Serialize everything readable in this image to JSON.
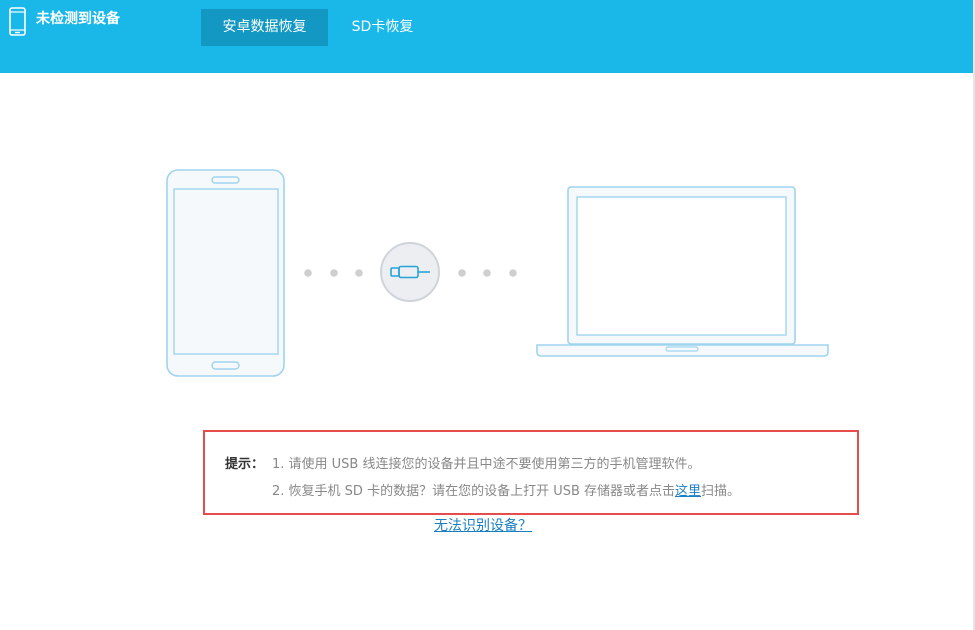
{
  "header": {
    "device_status": "未检测到设备",
    "tabs": [
      {
        "label": "安卓数据恢复",
        "active": true
      },
      {
        "label": "SD卡恢复",
        "active": false
      }
    ]
  },
  "main": {
    "connector_icon": "usb-plug-icon",
    "phone_icon": "smartphone-illustration",
    "laptop_icon": "laptop-illustration"
  },
  "tips": {
    "label": "提示：",
    "line1": "1. 请使用 USB 线连接您的设备并且中途不要使用第三方的手机管理软件。",
    "line2_before": "2. 恢复手机 SD 卡的数据？请在您的设备上打开 USB 存储器或者点击",
    "line2_link": "这里",
    "line2_after": "扫描。"
  },
  "help_link": "无法识别设备？",
  "colors": {
    "header_bg": "#1ab8e8",
    "active_tab_bg": "#1298c2",
    "illustration_stroke": "#9fd4ee",
    "tips_border": "#e64c4c",
    "link": "#1a7fc1"
  }
}
